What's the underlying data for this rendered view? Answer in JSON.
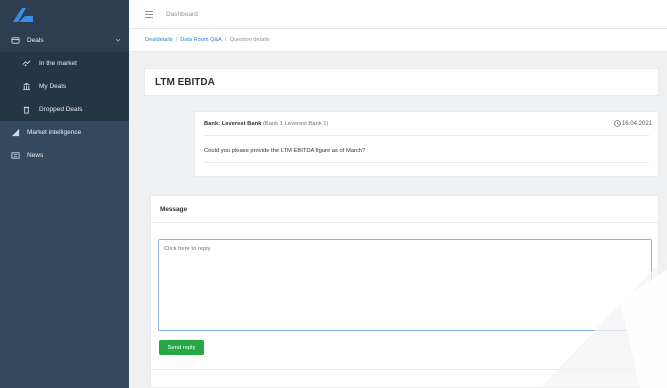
{
  "sidebar": {
    "logo_icon": "logo-icon",
    "groups": [
      {
        "label": "Deals",
        "icon": "folder-icon",
        "expanded": true,
        "children": [
          {
            "label": "In the market",
            "icon": "handshake-icon"
          },
          {
            "label": "My Deals",
            "icon": "bank-icon"
          },
          {
            "label": "Dropped Deals",
            "icon": "trash-icon"
          }
        ]
      },
      {
        "label": "Market intelligence",
        "icon": "chart-icon"
      },
      {
        "label": "News",
        "icon": "newspaper-icon"
      }
    ]
  },
  "topbar": {
    "title": "Dashboard"
  },
  "breadcrumb": {
    "items": [
      "Dealdetails",
      "Data Room Q&A",
      "Question details"
    ],
    "separator": "/"
  },
  "question": {
    "title": "LTM EBITDA",
    "bank_label": "Bank: Leverest Bank",
    "bank_detail": "(Bank 1 Leverest Bank 1)",
    "date": "16.04.2021",
    "text": "Could you please provide the LTM EBITDA figure as of March?"
  },
  "message": {
    "label": "Message",
    "placeholder": "Click here to reply",
    "value": "",
    "send_label": "Send reply"
  },
  "colors": {
    "sidebar_bg": "#35495e",
    "sidebar_dark": "#2c3e50",
    "link": "#2f7fd5",
    "send_button": "#28a745",
    "logo": "#3a8ee6"
  }
}
